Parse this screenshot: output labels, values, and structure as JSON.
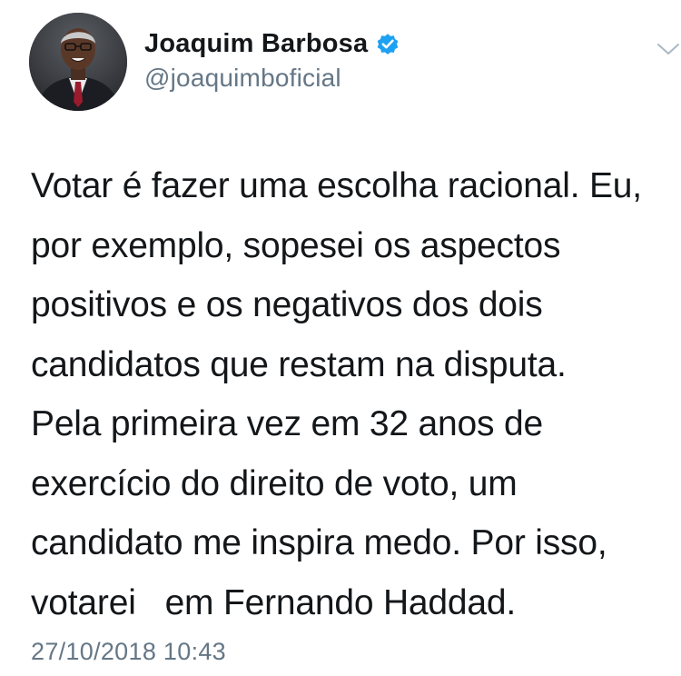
{
  "tweet": {
    "author": {
      "display_name": "Joaquim Barbosa",
      "handle": "@joaquimboficial",
      "verified": true,
      "avatar_icon": "profile-photo-icon"
    },
    "text": "Votar é fazer uma escolha racional. Eu,\npor exemplo, sopesei os aspectos\npositivos e os negativos dos dois\ncandidatos que restam na disputa.\nPela primeira vez em 32 anos de\nexercício do direito de voto, um\ncandidato me inspira medo. Por isso,\nvotarei   em Fernando Haddad.",
    "timestamp": "27/10/2018 10:43",
    "menu_icon": "chevron-down-icon"
  },
  "colors": {
    "text": "#14171a",
    "secondary": "#657786",
    "verified_badge": "#1da1f2",
    "background": "#ffffff"
  }
}
